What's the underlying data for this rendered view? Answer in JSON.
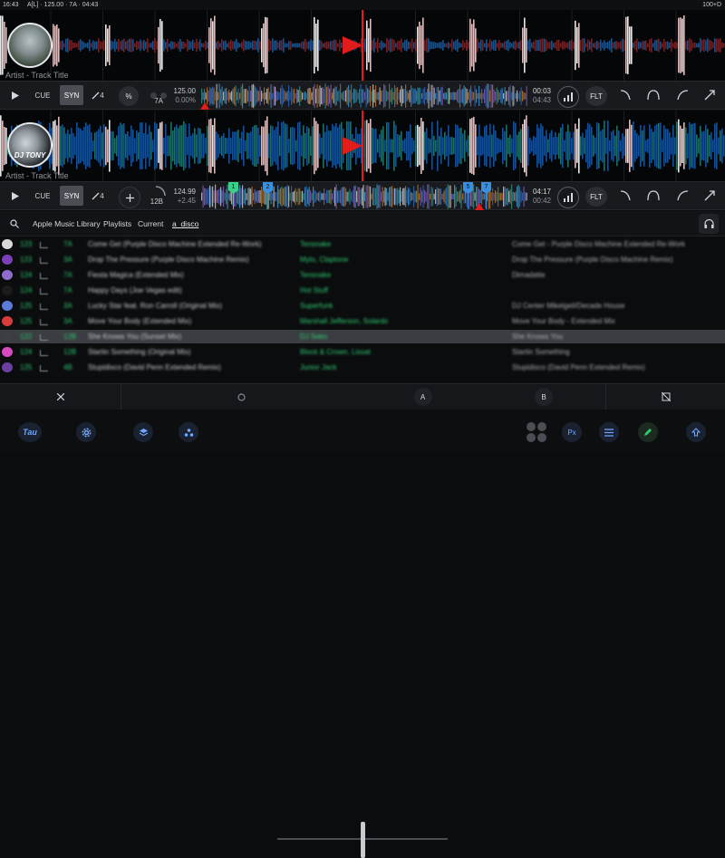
{
  "status_bar": {
    "time": "16:43",
    "center": "A[L] · 125.00 · 7A · 04:43",
    "right": "100+D"
  },
  "deck_a": {
    "track_title": "Artist - Track Title",
    "cue_label": "CUE",
    "sync_label": "SYN",
    "loop_value": "4",
    "pitch_button": "%",
    "key": "7A",
    "bpm": "125.00",
    "pitch": "0.00%",
    "elapsed": "00:03",
    "remaining": "04:43",
    "filter_label": "FLT"
  },
  "deck_b": {
    "track_title": "Artist - Track Title",
    "art_text": "DJ TONY",
    "cue_label": "CUE",
    "sync_label": "SYN",
    "loop_value": "4",
    "key": "12B",
    "bpm": "124.99",
    "pitch": "+2.45",
    "elapsed": "04:17",
    "remaining": "00:42",
    "filter_label": "FLT",
    "cue_markers": [
      "1",
      "2",
      "5",
      "7"
    ]
  },
  "browser": {
    "breadcrumbs": [
      "Apple Music Library",
      "Playlists",
      "Current",
      "a_disco"
    ],
    "rows": [
      {
        "bpm": "123",
        "key": "7A",
        "title": "Come Get (Purple Disco Machine Extended Re-Work)",
        "artist": "Tensnake",
        "album": "Come Get - Purple Disco Machine Extended Re-Work",
        "color": "#d9d9d9",
        "selected": false
      },
      {
        "bpm": "123",
        "key": "3A",
        "title": "Drop The Pressure (Purple Disco Machine Remix)",
        "artist": "Mylo, Claptone",
        "album": "Drop The Pressure (Purple Disco Machine Remix)",
        "color": "#7b3fb8",
        "selected": false
      },
      {
        "bpm": "124",
        "key": "7A",
        "title": "Fiesta Magica (Extended Mix)",
        "artist": "Tensnake",
        "album": "Dimadatte",
        "color": "#8f6bcc",
        "selected": false
      },
      {
        "bpm": "124",
        "key": "7A",
        "title": "Happy Days (Joe Vegas edit)",
        "artist": "Hot Stuff",
        "album": "",
        "color": "#1b1b1b",
        "selected": false
      },
      {
        "bpm": "125",
        "key": "3A",
        "title": "Lucky Star feat. Ron Carroll (Original Mix)",
        "artist": "Superfunk",
        "album": "DJ Center Mikelgeil/Decade House",
        "color": "#5a7bd8",
        "selected": false
      },
      {
        "bpm": "125",
        "key": "3A",
        "title": "Move Your Body (Extended Mix)",
        "artist": "Marshall Jefferson, Solardo",
        "album": "Move Your Body - Extended Mix",
        "color": "#d83b3b",
        "selected": false
      },
      {
        "bpm": "122",
        "key": "12B",
        "title": "She Knows You (Sunset Mix)",
        "artist": "DJ Seko",
        "album": "She Knows You",
        "color": "#3c3f43",
        "selected": true
      },
      {
        "bpm": "124",
        "key": "12B",
        "title": "Startin Something (Original Mix)",
        "artist": "Block & Crown, Lissat",
        "album": "Startin Something",
        "color": "#d84ac0",
        "selected": false
      },
      {
        "bpm": "125",
        "key": "4B",
        "title": "Stupidisco (David Penn Extended Remix)",
        "artist": "Junior Jack",
        "album": "Stupidisco (David Penn Extended Remix)",
        "color": "#6b3fa0",
        "selected": false
      }
    ]
  },
  "tabbar": {
    "a_label": "A",
    "b_label": "B"
  },
  "bottom": {
    "logo": "Tau",
    "px_label": "Px"
  },
  "crossfader": {
    "position": 0.5
  },
  "colors": {
    "playhead": "#e21b1b",
    "accent_green": "#2ecc71",
    "sync_bg": "#4a4e54"
  }
}
